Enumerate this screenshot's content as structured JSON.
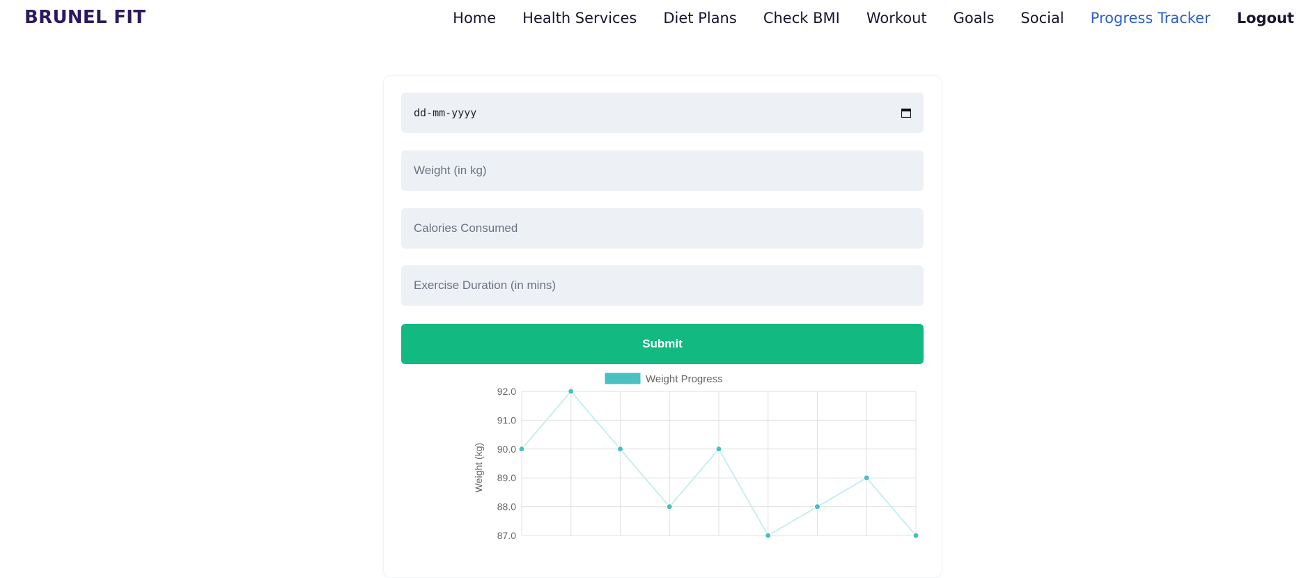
{
  "nav": {
    "brand": "BRUNEL FIT",
    "links": [
      "Home",
      "Health Services",
      "Diet Plans",
      "Check BMI",
      "Workout",
      "Goals",
      "Social",
      "Progress Tracker",
      "Logout"
    ],
    "active": "Progress Tracker",
    "bold": "Logout"
  },
  "form": {
    "date_placeholder": "dd-mm-yyyy",
    "weight_placeholder": "Weight (in kg)",
    "calories_placeholder": "Calories Consumed",
    "exercise_placeholder": "Exercise Duration (in mins)",
    "submit_label": "Submit"
  },
  "colors": {
    "brand": "#2b1a5e",
    "active_link": "#2f5fc9",
    "submit": "#12b981",
    "field_bg": "#edf1f5",
    "series": "#4bc0c0"
  },
  "chart_data": {
    "type": "line",
    "legend": "Weight Progress",
    "ylabel": "Weight (kg)",
    "ylim": [
      87,
      92
    ],
    "yticks": [
      "92.0",
      "91.0",
      "90.0",
      "89.0",
      "88.0",
      "87.0"
    ],
    "values": [
      90,
      92,
      90,
      88,
      90,
      87,
      88,
      89,
      87
    ]
  }
}
